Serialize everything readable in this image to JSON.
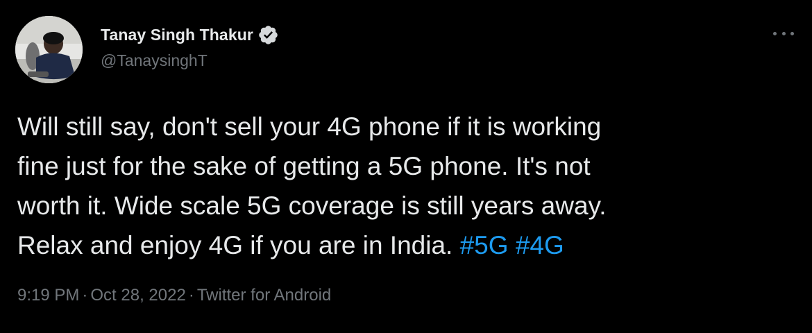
{
  "author": {
    "display_name": "Tanay Singh Thakur",
    "handle": "@TanaysinghT",
    "verified": true
  },
  "tweet": {
    "lines": [
      "Will still say, don't sell your 4G phone if it is working",
      "fine just for the sake of getting a 5G phone. It's not",
      "worth it. Wide scale 5G coverage is still years away.",
      "Relax and enjoy 4G if you are in India. "
    ],
    "hashtags": [
      "#5G",
      "#4G"
    ]
  },
  "meta": {
    "time": "9:19 PM",
    "separator": "·",
    "date": "Oct 28, 2022",
    "source": "Twitter for Android"
  },
  "icons": {
    "verified": "verified-badge-icon",
    "more": "more-horizontal-icon"
  },
  "colors": {
    "background": "#000000",
    "text": "#e7e9ea",
    "secondary": "#71767b",
    "accent": "#1d9bf0"
  }
}
